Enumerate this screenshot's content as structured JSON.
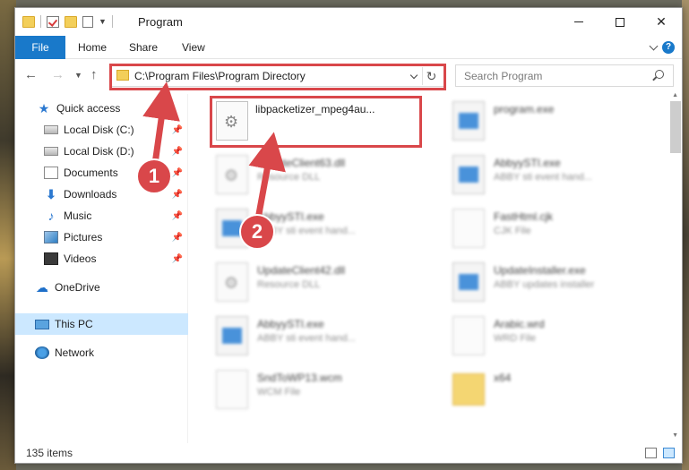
{
  "window": {
    "title": "Program",
    "tabs": [
      "File",
      "Home",
      "Share",
      "View"
    ]
  },
  "navbar": {
    "address": "C:\\Program Files\\Program Directory",
    "search_placeholder": "Search Program"
  },
  "sidebar": {
    "items": [
      {
        "label": "Quick access",
        "icon": "star-icon"
      },
      {
        "label": "Local Disk (C:)",
        "icon": "disk-icon",
        "pinned": true
      },
      {
        "label": "Local Disk (D:)",
        "icon": "disk-icon",
        "pinned": true
      },
      {
        "label": "Documents",
        "icon": "documents-icon",
        "pinned": true
      },
      {
        "label": "Downloads",
        "icon": "download-icon",
        "pinned": true
      },
      {
        "label": "Music",
        "icon": "music-icon",
        "pinned": true
      },
      {
        "label": "Pictures",
        "icon": "pictures-icon",
        "pinned": true
      },
      {
        "label": "Videos",
        "icon": "videos-icon",
        "pinned": true
      },
      {
        "label": "OneDrive",
        "icon": "cloud-icon"
      },
      {
        "label": "This PC",
        "icon": "computer-icon",
        "selected": true
      },
      {
        "label": "Network",
        "icon": "network-icon"
      }
    ]
  },
  "files": [
    {
      "name": "libpacketizer_mpeg4au...",
      "sub": "",
      "icon": "dll-file-icon",
      "highlighted": true
    },
    {
      "name": "program.exe",
      "sub": "",
      "icon": "exe-file-icon"
    },
    {
      "name": "UpdateClient63.dll",
      "sub": "Resource DLL",
      "icon": "dll-file-icon"
    },
    {
      "name": "AbbyySTI.exe",
      "sub": "ABBY sti event hand...",
      "icon": "exe-file-icon"
    },
    {
      "name": "AbbyySTI.exe",
      "sub": "ABBY sti event hand...",
      "icon": "exe-file-icon"
    },
    {
      "name": "FastHtml.cjk",
      "sub": "CJK File",
      "icon": "generic-file-icon"
    },
    {
      "name": "UpdateClient42.dll",
      "sub": "Resource DLL",
      "icon": "dll-file-icon"
    },
    {
      "name": "UpdateInstaller.exe",
      "sub": "ABBY updates installer",
      "icon": "exe-file-icon"
    },
    {
      "name": "AbbyySTI.exe",
      "sub": "ABBY sti event hand...",
      "icon": "exe-file-icon"
    },
    {
      "name": "Arabic.wrd",
      "sub": "WRD File",
      "icon": "generic-file-icon"
    },
    {
      "name": "SndToWP13.wcm",
      "sub": "WCM File",
      "icon": "generic-file-icon"
    },
    {
      "name": "x64",
      "sub": "",
      "icon": "folder-icon"
    }
  ],
  "status": {
    "items_count": "135 items"
  },
  "annotations": {
    "step1": "1",
    "step2": "2"
  },
  "colors": {
    "accent": "#1979ca",
    "highlight": "#d9474a",
    "selected": "#cce8ff"
  }
}
